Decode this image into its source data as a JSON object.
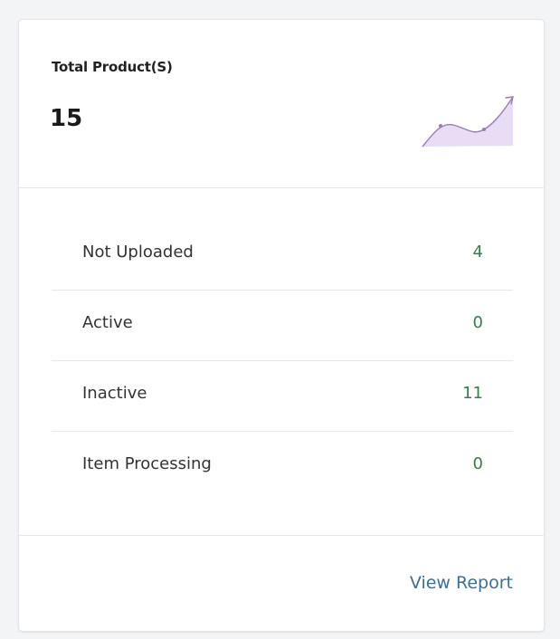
{
  "summary": {
    "title": "Total Product(S)",
    "value": "15",
    "trend_icon": "trend-up-icon",
    "trend_color": "#9b7ab8"
  },
  "stats": [
    {
      "label": "Not Uploaded",
      "value": "4"
    },
    {
      "label": "Active",
      "value": "0"
    },
    {
      "label": "Inactive",
      "value": "11"
    },
    {
      "label": "Item Processing",
      "value": "0"
    }
  ],
  "footer": {
    "link_label": "View Report"
  },
  "colors": {
    "value_text": "#3b7a4c",
    "link_text": "#3f6f8f",
    "background": "#f3f4f6"
  }
}
